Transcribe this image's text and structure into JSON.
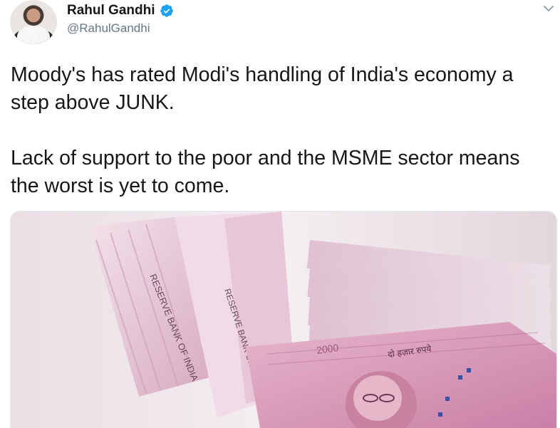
{
  "author": {
    "name": "Rahul Gandhi",
    "handle": "@RahulGandhi",
    "verified": true,
    "avatar_icon": "profile-photo"
  },
  "tweet": {
    "paragraphs": [
      "Moody's has rated Modi's handling of India's economy a step above JUNK.",
      "Lack of support to the poor and the MSME sector means the worst is yet to come."
    ]
  },
  "media": {
    "icon": "currency-notes-photo",
    "note_text_left": "RESERVE BANK OF INDIA",
    "note_text_mid": "RESERVE BANK OF INDIA",
    "note_text_hindi": "दो हज़ार रुपये",
    "note_number": "2000",
    "colors": {
      "note_pink": "#d79ab7",
      "note_light": "#f1d7e4"
    }
  },
  "ui": {
    "menu_icon": "chevron-down-icon",
    "verified_color": "#1da1f2"
  }
}
